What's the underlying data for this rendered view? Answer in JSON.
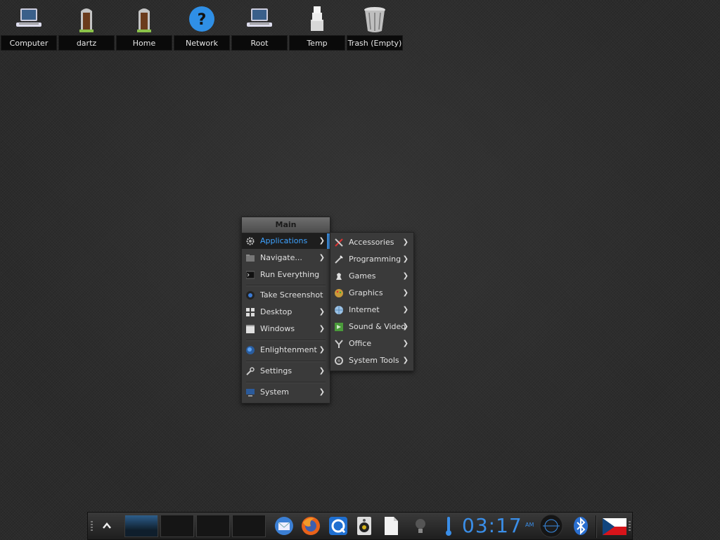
{
  "desktop": {
    "icons": [
      {
        "label": "Computer",
        "icon": "computer-icon"
      },
      {
        "label": "dartz",
        "icon": "home-door-icon"
      },
      {
        "label": "Home",
        "icon": "home-door-icon"
      },
      {
        "label": "Network",
        "icon": "network-question-icon"
      },
      {
        "label": "Root",
        "icon": "computer-icon"
      },
      {
        "label": "Temp",
        "icon": "temp-folder-icon"
      },
      {
        "label": "Trash (Empty)",
        "icon": "trash-icon"
      }
    ]
  },
  "main_menu": {
    "title": "Main",
    "items": [
      {
        "label": "Applications",
        "icon": "gear-icon",
        "submenu": true,
        "active": true
      },
      {
        "label": "Navigate...",
        "icon": "folder-icon",
        "submenu": true
      },
      {
        "label": "Run Everything",
        "icon": "terminal-icon",
        "submenu": false
      },
      {
        "label": "Take Screenshot",
        "icon": "camera-icon",
        "submenu": false
      },
      {
        "label": "Desktop",
        "icon": "desktop-grid-icon",
        "submenu": true
      },
      {
        "label": "Windows",
        "icon": "window-icon",
        "submenu": true
      },
      {
        "label": "Enlightenment",
        "icon": "enlightenment-icon",
        "submenu": true
      },
      {
        "label": "Settings",
        "icon": "wrench-icon",
        "submenu": true
      },
      {
        "label": "System",
        "icon": "monitor-icon",
        "submenu": true
      }
    ]
  },
  "applications_menu": {
    "items": [
      {
        "label": "Accessories",
        "icon": "accessories-icon"
      },
      {
        "label": "Programming",
        "icon": "programming-icon"
      },
      {
        "label": "Games",
        "icon": "games-icon"
      },
      {
        "label": "Graphics",
        "icon": "graphics-icon"
      },
      {
        "label": "Internet",
        "icon": "globe-icon"
      },
      {
        "label": "Sound & Video",
        "icon": "sound-video-icon"
      },
      {
        "label": "Office",
        "icon": "office-icon"
      },
      {
        "label": "System Tools",
        "icon": "system-tools-icon"
      }
    ]
  },
  "shelf": {
    "clock_time": "03:17",
    "clock_ampm": "AM",
    "launchers": [
      "mail-icon",
      "firefox-icon",
      "browser-icon",
      "speaker-icon",
      "document-icon"
    ],
    "tray": [
      "lightbulb-icon",
      "thermometer-icon",
      "clock",
      "mixer-icon",
      "bluetooth-icon",
      "czech-flag-icon"
    ],
    "accent_color": "#3a8ee8"
  }
}
